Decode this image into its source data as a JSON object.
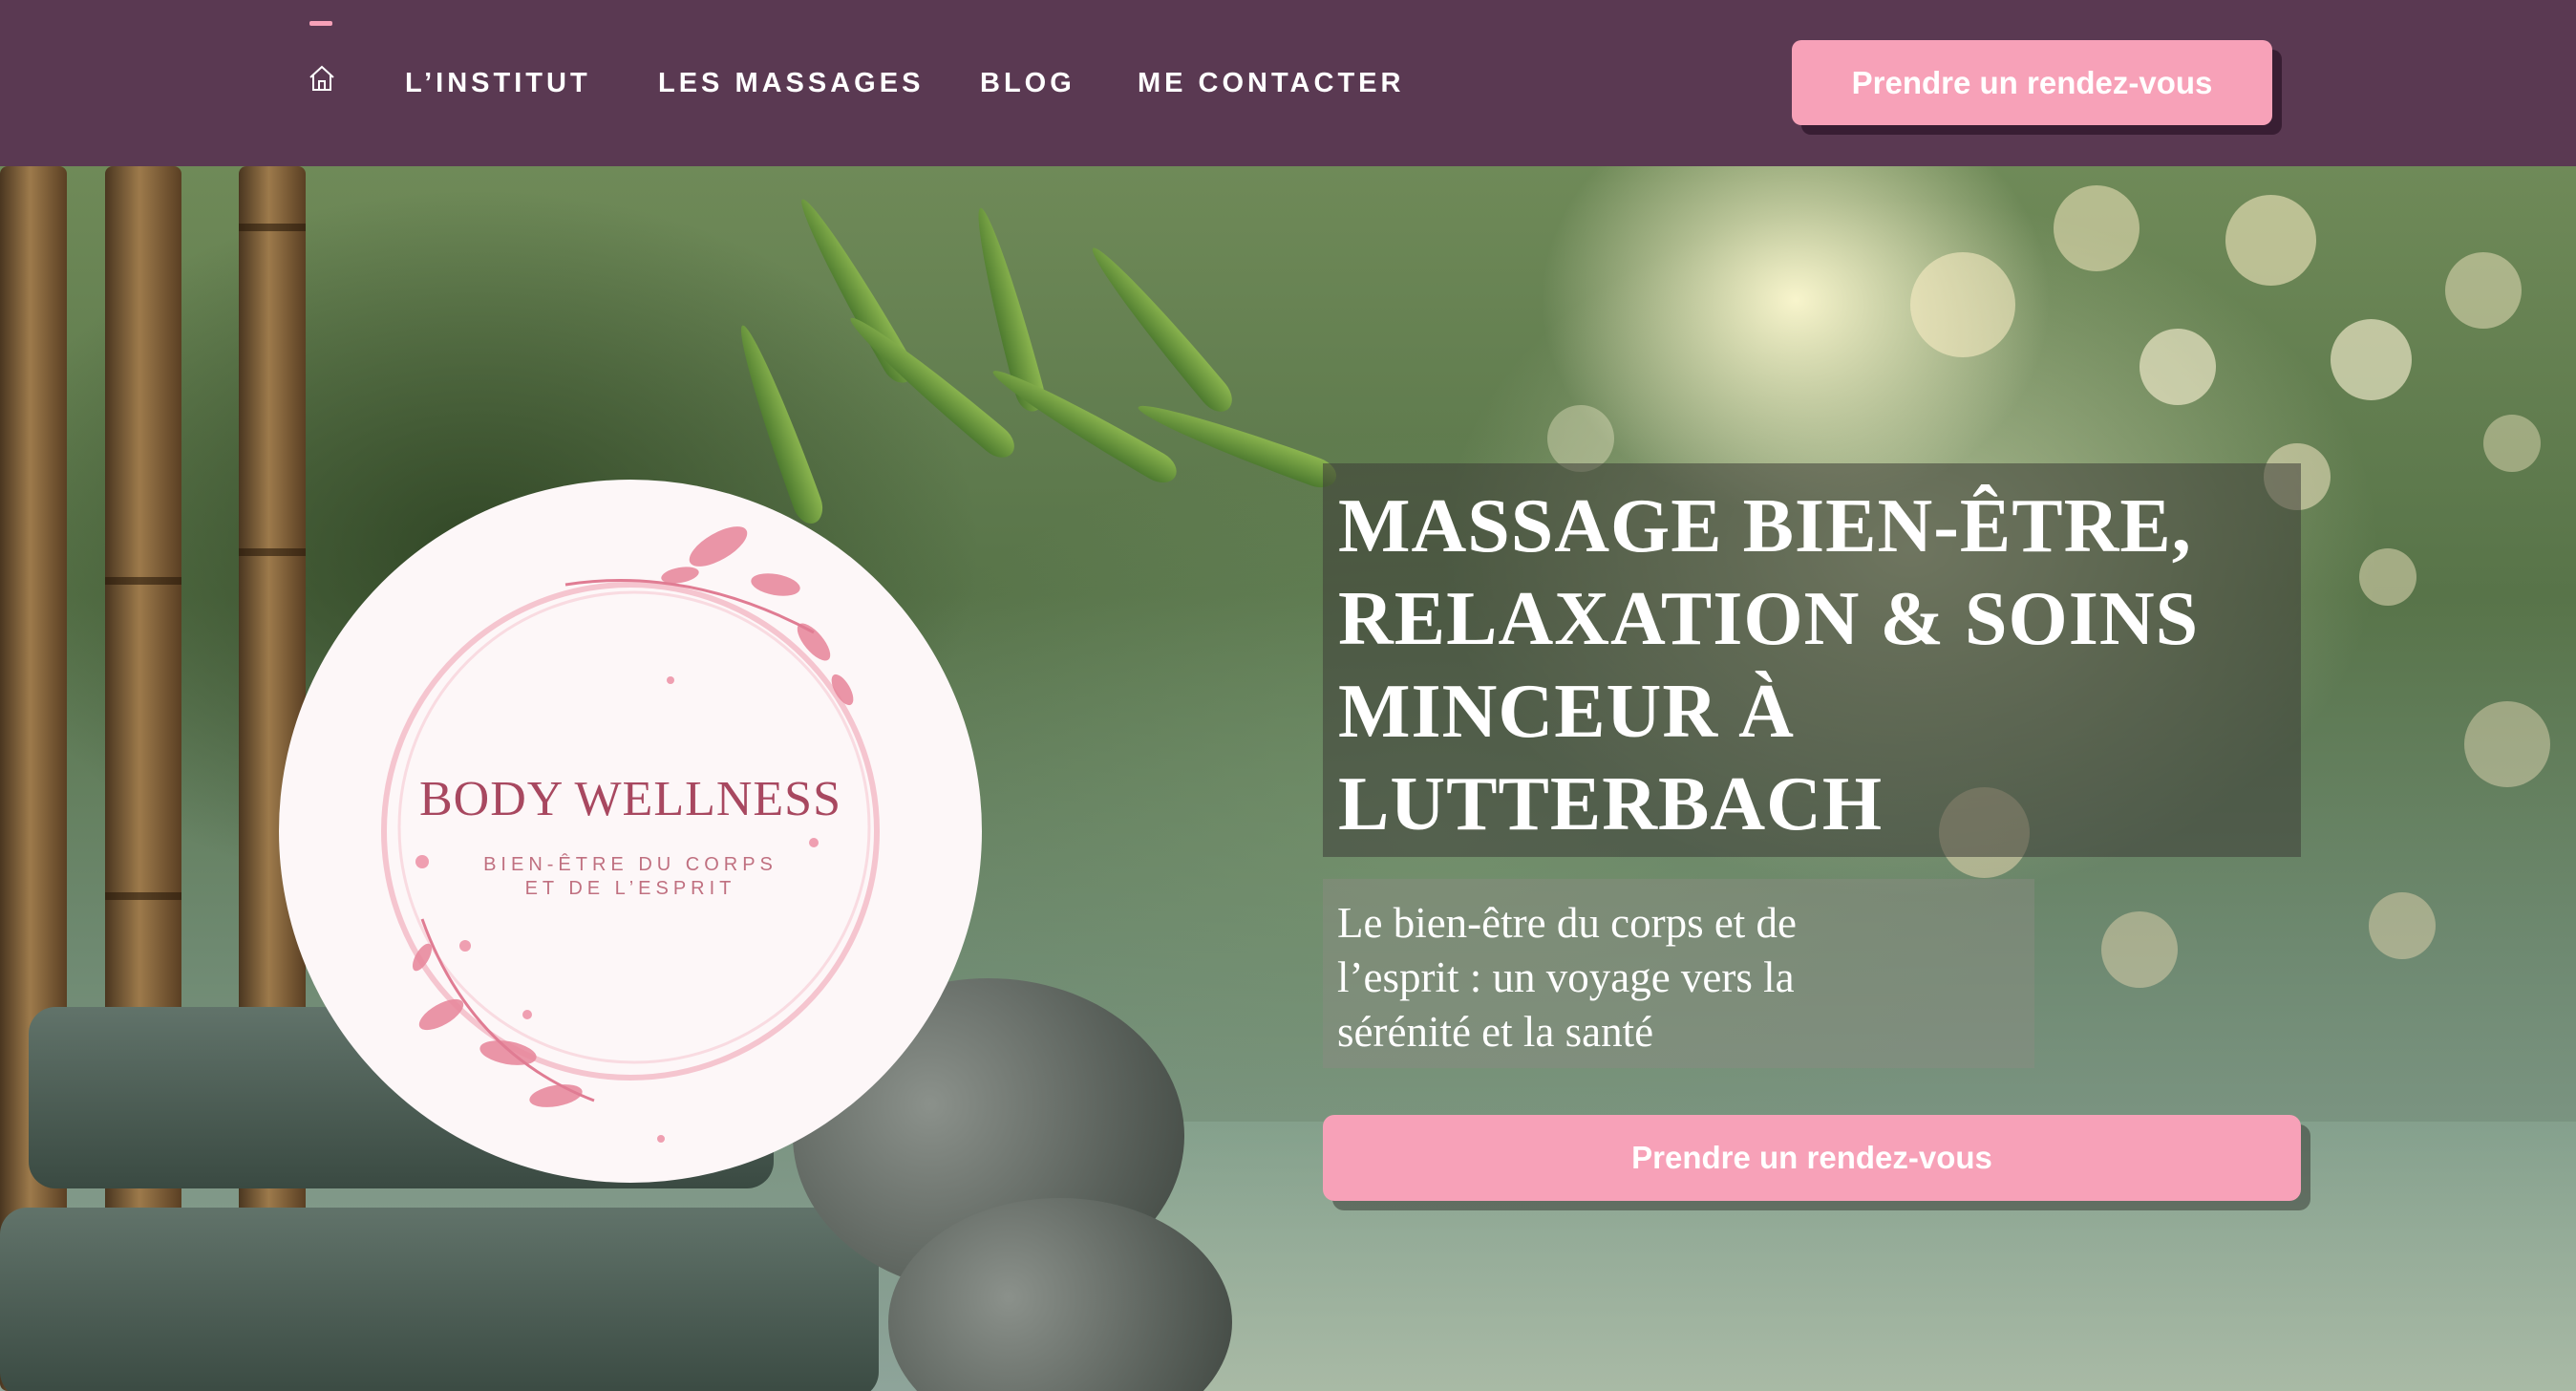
{
  "nav": {
    "home_icon": "home-icon",
    "items": [
      {
        "label": "L’INSTITUT"
      },
      {
        "label": "LES MASSAGES"
      },
      {
        "label": "BLOG"
      },
      {
        "label": "ME CONTACTER"
      }
    ],
    "cta_label": "Prendre un rendez-vous"
  },
  "logo": {
    "title": "BODY WELLNESS",
    "subtitle_line1": "BIEN-ÊTRE DU CORPS",
    "subtitle_line2": "ET DE L’ESPRIT"
  },
  "hero": {
    "headline": "MASSAGE BIEN-ÊTRE,\nRELAXATION & SOINS\nMINCEUR À\nLUTTERBACH",
    "subline": "Le bien-être du corps et de\nl’esprit : un voyage vers la\nsérénité et la santé",
    "cta_label": "Prendre un rendez-vous"
  },
  "colors": {
    "header_bg": "#5a3952",
    "accent_pink": "#f7a1b8",
    "logo_text": "#a84860"
  }
}
